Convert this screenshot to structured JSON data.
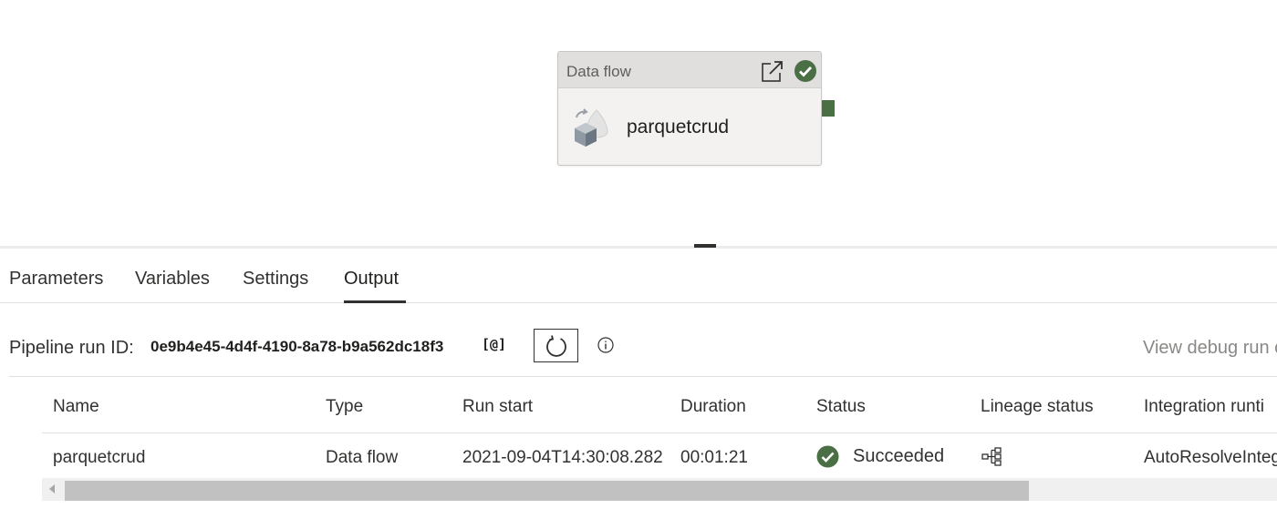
{
  "canvas": {
    "activity": {
      "type_label": "Data flow",
      "name": "parquetcrud",
      "status": "succeeded"
    }
  },
  "tabs": [
    {
      "label": "Parameters",
      "active": false
    },
    {
      "label": "Variables",
      "active": false
    },
    {
      "label": "Settings",
      "active": false
    },
    {
      "label": "Output",
      "active": true
    }
  ],
  "run": {
    "label": "Pipeline run ID:",
    "id": "0e9b4e45-4d4f-4190-8a78-b9a562dc18f3",
    "copy_glyph": "[@]",
    "view_debug_label": "View debug run c"
  },
  "table": {
    "columns": [
      "Name",
      "Type",
      "Run start",
      "Duration",
      "Status",
      "Lineage status",
      "Integration runti"
    ],
    "rows": [
      {
        "name": "parquetcrud",
        "type": "Data flow",
        "run_start": "2021-09-04T14:30:08.282",
        "duration": "00:01:21",
        "status": "Succeeded",
        "lineage_icon": "lineage-icon",
        "integration_runtime": "AutoResolveInteg"
      }
    ]
  },
  "colors": {
    "success": "#4b6f44",
    "text": "#323130",
    "link_muted": "#8a8886"
  }
}
